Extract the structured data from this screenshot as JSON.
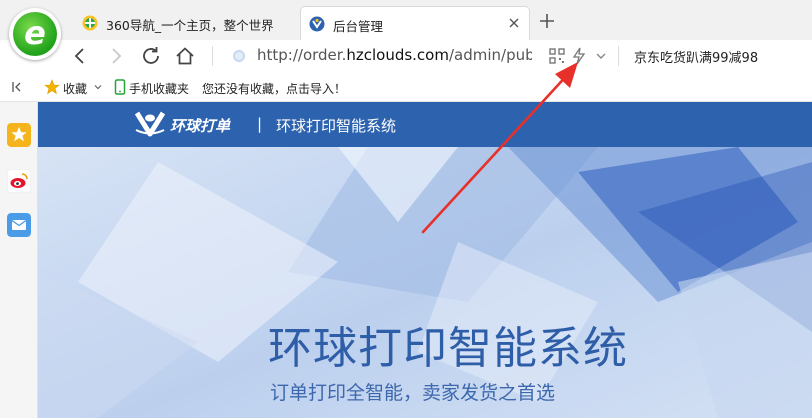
{
  "browser": {
    "tabs": [
      {
        "title": "360导航_一个主页，整个世界",
        "active": false
      },
      {
        "title": "后台管理",
        "active": true
      }
    ],
    "address": {
      "prefix": "http://order.",
      "domain": "hzclouds.com",
      "suffix": "/admin/pub/lc"
    },
    "promo_text": "京东吃货趴满99减98",
    "bookmarks": {
      "favorites_label": "收藏",
      "mobile_label": "手机收藏夹",
      "import_hint": "您还没有收藏，点击导入！"
    }
  },
  "site": {
    "brand_name": "环球打单",
    "brand_separator": "|",
    "brand_subtitle": "环球打印智能系统",
    "hero_title": "环球打印智能系统",
    "hero_subtitle": "订单打印全智能，卖家发货之首选"
  },
  "colors": {
    "header_blue": "#2c62ae",
    "hero_title": "#2f5ea8",
    "annotation_arrow": "#e8302a",
    "browser_green": "#1fa21a"
  }
}
